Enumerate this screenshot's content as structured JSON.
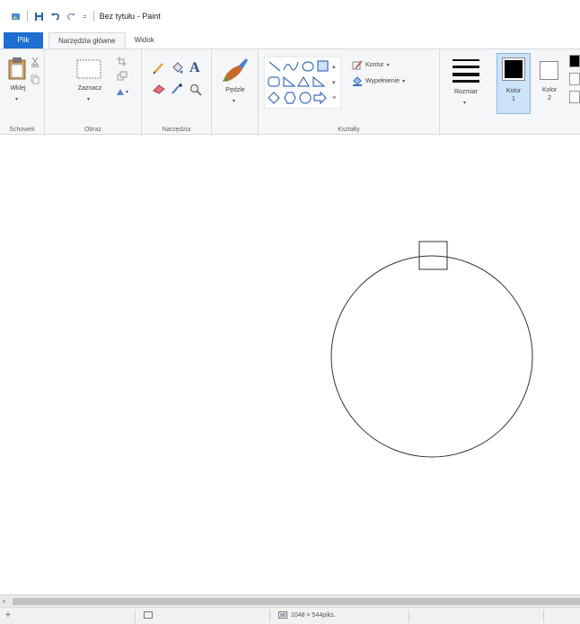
{
  "window": {
    "title": "Bez tytułu - Paint"
  },
  "tabs": [
    {
      "label": "Plik"
    },
    {
      "label": "Narzędzia główne"
    },
    {
      "label": "Widok"
    }
  ],
  "ribbon": {
    "clipboard": {
      "paste_label": "Wklej",
      "group_label": "Schowek"
    },
    "image": {
      "select_label": "Zaznacz",
      "group_label": "Obraz"
    },
    "tools": {
      "group_label": "Narzędzia",
      "text_tool_glyph": "A"
    },
    "brushes": {
      "label": "Pędzle"
    },
    "shapes": {
      "outline_label": "Kontur",
      "fill_label": "Wypełnienie",
      "group_label": "Kształty"
    },
    "size": {
      "label": "Rozmiar"
    },
    "colors": {
      "color1_label": "Kolor",
      "color1_number": "1",
      "color2_label": "Kolor",
      "color2_number": "2",
      "color1_value": "#000000",
      "color2_value": "#ffffff"
    }
  },
  "status": {
    "dimensions": "1048 × 544piks."
  },
  "accent": "#1e6fd1"
}
